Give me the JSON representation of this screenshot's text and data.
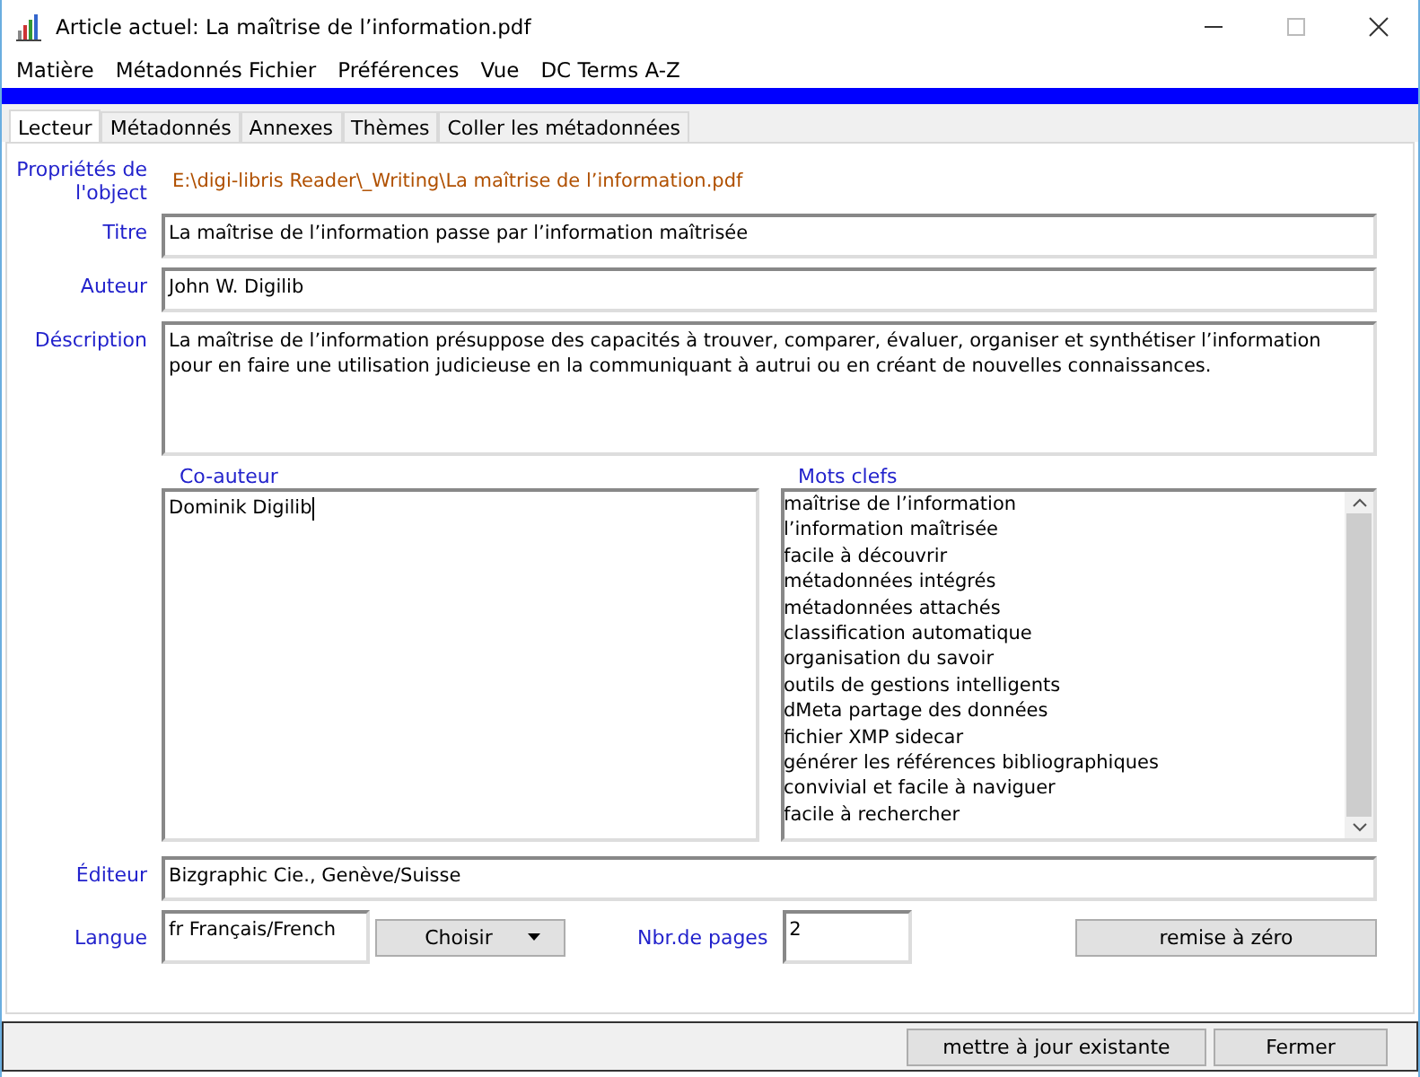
{
  "window": {
    "title": "Article actuel: La maîtrise de l’information.pdf"
  },
  "menu": [
    "Matière",
    "Métadonnés Fichier",
    "Préférences",
    "Vue",
    "DC Terms A-Z"
  ],
  "tabs": [
    {
      "label": "Lecteur",
      "selected": true
    },
    {
      "label": "Métadonnés",
      "selected": false
    },
    {
      "label": "Annexes",
      "selected": false
    },
    {
      "label": "Thèmes",
      "selected": false
    },
    {
      "label": "Coller les métadonnées",
      "selected": false
    }
  ],
  "properties": {
    "label": "Propriétés de l'object",
    "path": "E:\\digi-libris Reader\\_Writing\\La maîtrise de l’information.pdf"
  },
  "fields": [
    {
      "label": "Titre",
      "value": "La maîtrise de l’information passe par l’information maîtrisée",
      "kind": "line"
    },
    {
      "label": "Auteur",
      "value": "John W. Digilib",
      "kind": "line"
    },
    {
      "label": "Déscription",
      "value": "La maîtrise de l’information présuppose des capacités à trouver, comparer, évaluer, organiser et synthétiser l’information pour en faire une utilisation judicieuse en la communiquant à autrui ou en créant de nouvelles connaissances.",
      "kind": "area"
    }
  ],
  "coauthor": {
    "label": "Co-auteur",
    "value": "Dominik Digilib"
  },
  "keywords": {
    "label": "Mots clefs",
    "items": [
      "maîtrise de l’information",
      "l’information maîtrisée",
      "facile à découvrir",
      "métadonnées intégrés",
      "métadonnées attachés",
      "classification automatique",
      "organisation du savoir",
      "outils de gestions intelligents",
      "dMeta partage des données",
      "fichier XMP sidecar",
      "générer les références bibliographiques",
      "convivial et facile à naviguer",
      "facile à rechercher"
    ]
  },
  "publisher": {
    "label": "Éditeur",
    "value": "Bizgraphic Cie., Genève/Suisse"
  },
  "language": {
    "label": "Langue",
    "value": "fr Français/French",
    "button": "Choisir"
  },
  "pages": {
    "label": "Nbr.de pages",
    "value": "2"
  },
  "reset_button": "remise à zéro",
  "footer_buttons": [
    "mettre à jour existante",
    "Fermer"
  ]
}
